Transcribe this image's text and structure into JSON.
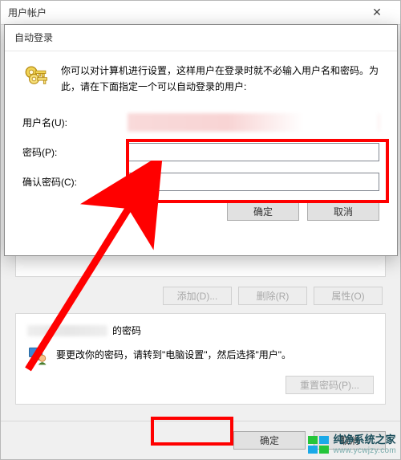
{
  "outer": {
    "title": "用户帐户",
    "panel_buttons": {
      "add": "添加(D)...",
      "remove": "删除(R)",
      "properties": "属性(O)"
    },
    "password_section": {
      "title_suffix": "的密码",
      "hint": "要更改你的密码，请转到\"电脑设置\"，然后选择\"用户\"。",
      "reset": "重置密码(P)..."
    },
    "ok": "确定",
    "cancel": "取消"
  },
  "inner": {
    "title": "自动登录",
    "intro": "你可以对计算机进行设置，这样用户在登录时就不必输入用户名和密码。为此，请在下面指定一个可以自动登录的用户:",
    "labels": {
      "username": "用户名(U):",
      "password": "密码(P):",
      "confirm": "确认密码(C):"
    },
    "ok": "确定",
    "cancel": "取消"
  },
  "watermark": {
    "line1": "纯净系统之家",
    "line2": "www.ycwjzy.com"
  },
  "colors": {
    "annotation": "#ff0000"
  }
}
